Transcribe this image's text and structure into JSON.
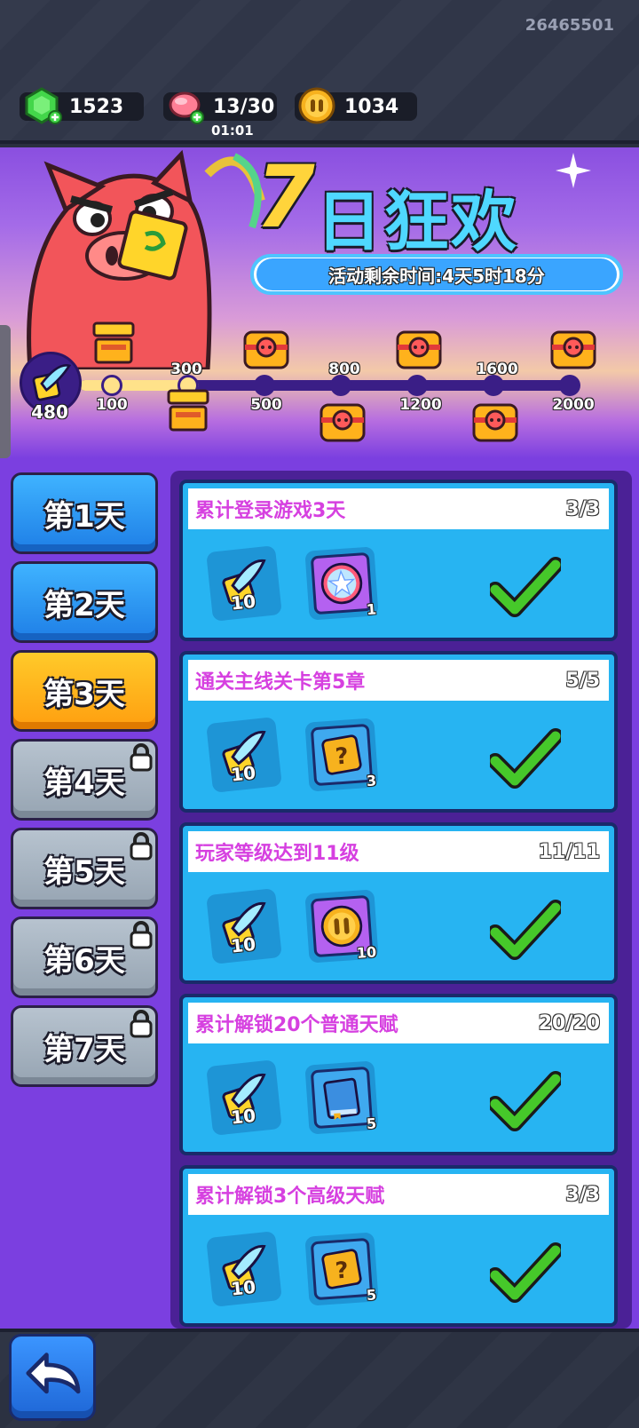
{
  "header": {
    "user_id": "26465501",
    "gems": "1523",
    "energy": "13/30",
    "energy_timer": "01:01",
    "coins": "1034"
  },
  "banner": {
    "title_number": "7",
    "title_text": "日狂欢",
    "remaining_time": "活动剩余时间:4天5时18分",
    "score": "480",
    "milestones_bottom": [
      "100",
      "500",
      "1200",
      "2000"
    ],
    "milestones_top": [
      "300",
      "800",
      "1600"
    ],
    "progress_fraction": 0.24
  },
  "days": [
    {
      "label": "第1天",
      "state": "unlocked"
    },
    {
      "label": "第2天",
      "state": "unlocked"
    },
    {
      "label": "第3天",
      "state": "selected"
    },
    {
      "label": "第4天",
      "state": "locked"
    },
    {
      "label": "第5天",
      "state": "locked"
    },
    {
      "label": "第6天",
      "state": "locked"
    },
    {
      "label": "第7天",
      "state": "locked"
    }
  ],
  "tasks": [
    {
      "title": "累计登录游戏3天",
      "progress": "3/3",
      "reward1_qty": "10",
      "reward2_icon": "star-orb-icon",
      "reward2_qty": "1",
      "completed": true
    },
    {
      "title": "通关主线关卡第5章",
      "progress": "5/5",
      "reward1_qty": "10",
      "reward2_icon": "mystery-box-icon",
      "reward2_qty": "3",
      "completed": true
    },
    {
      "title": "玩家等级达到11级",
      "progress": "11/11",
      "reward1_qty": "10",
      "reward2_icon": "coin-icon",
      "reward2_qty": "10",
      "completed": true
    },
    {
      "title": "累计解锁20个普通天赋",
      "progress": "20/20",
      "reward1_qty": "10",
      "reward2_icon": "book-icon",
      "reward2_qty": "5",
      "completed": true
    },
    {
      "title": "累计解锁3个高级天赋",
      "progress": "3/3",
      "reward1_qty": "10",
      "reward2_icon": "mystery-box-icon",
      "reward2_qty": "5",
      "completed": true
    }
  ],
  "colors": {
    "accent_purple": "#7b3fe0",
    "task_blue": "#27b4f2",
    "title_magenta": "#d640e0",
    "selected_orange": "#ffb21c",
    "check_green": "#46c82a"
  }
}
